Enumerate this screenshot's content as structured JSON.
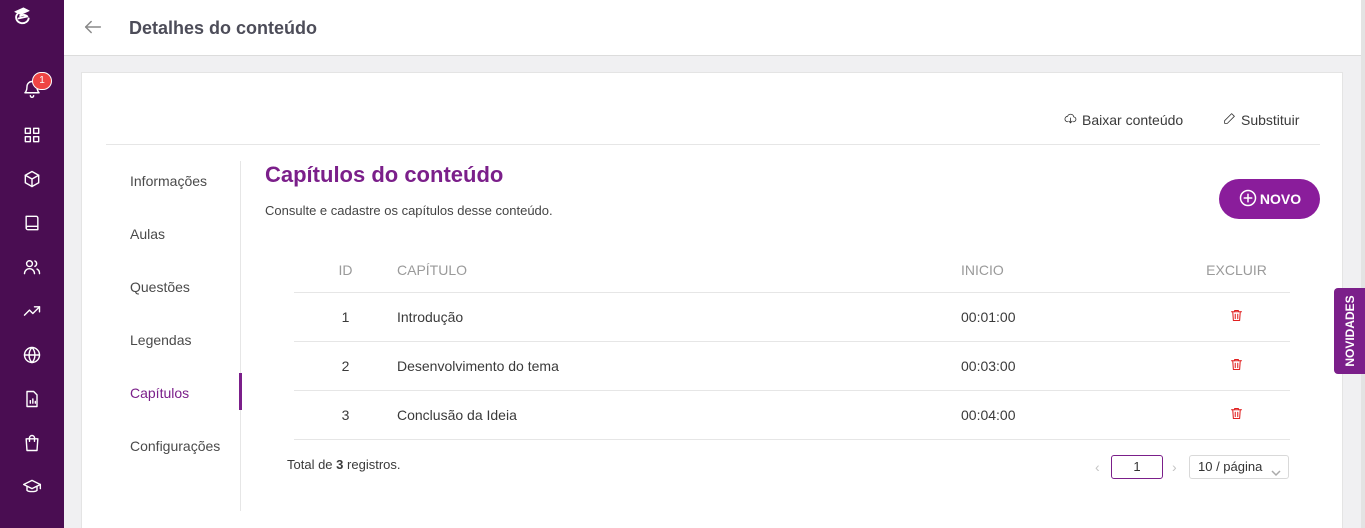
{
  "header": {
    "title": "Detalhes do conteúdo"
  },
  "rail": {
    "notification_count": "1",
    "icons": [
      "bell-icon",
      "grid-icon",
      "cube-icon",
      "book-icon",
      "users-icon",
      "trending-icon",
      "globe-icon",
      "report-icon",
      "bag-icon",
      "graduation-icon"
    ]
  },
  "actions": {
    "download": "Baixar conteúdo",
    "replace": "Substituir"
  },
  "sidenav": {
    "items": [
      "Informações",
      "Aulas",
      "Questões",
      "Legendas",
      "Capítulos",
      "Configurações"
    ],
    "active": "Capítulos"
  },
  "section": {
    "title": "Capítulos do conteúdo",
    "subtitle": "Consulte e cadastre os capítulos desse conteúdo.",
    "new_button": "NOVO"
  },
  "table": {
    "headers": [
      "ID",
      "CAPÍTULO",
      "INICIO",
      "EXCLUIR"
    ],
    "rows": [
      {
        "id": "1",
        "chapter": "Introdução",
        "start": "00:01:00"
      },
      {
        "id": "2",
        "chapter": "Desenvolvimento do tema",
        "start": "00:03:00"
      },
      {
        "id": "3",
        "chapter": "Conclusão da Ideia",
        "start": "00:04:00"
      }
    ]
  },
  "footer": {
    "total_prefix": "Total de",
    "total_count": "3",
    "total_suffix": "registros.",
    "current_page": "1",
    "page_size": "10 / página"
  },
  "novidades": "NOVIDADES",
  "colors": {
    "rail": "#4a0d52",
    "accent": "#7b1f8a",
    "delete": "#e02020",
    "badge": "#ef4444"
  }
}
